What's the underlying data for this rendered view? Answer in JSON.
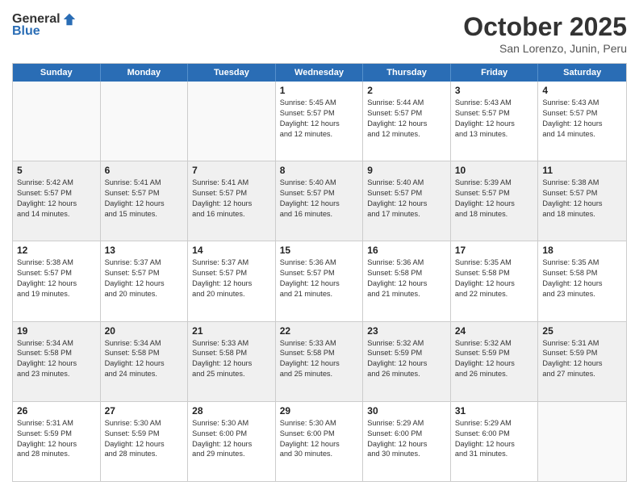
{
  "logo": {
    "general": "General",
    "blue": "Blue"
  },
  "title": "October 2025",
  "location": "San Lorenzo, Junin, Peru",
  "day_headers": [
    "Sunday",
    "Monday",
    "Tuesday",
    "Wednesday",
    "Thursday",
    "Friday",
    "Saturday"
  ],
  "weeks": [
    [
      {
        "day": "",
        "info": ""
      },
      {
        "day": "",
        "info": ""
      },
      {
        "day": "",
        "info": ""
      },
      {
        "day": "1",
        "info": "Sunrise: 5:45 AM\nSunset: 5:57 PM\nDaylight: 12 hours\nand 12 minutes."
      },
      {
        "day": "2",
        "info": "Sunrise: 5:44 AM\nSunset: 5:57 PM\nDaylight: 12 hours\nand 12 minutes."
      },
      {
        "day": "3",
        "info": "Sunrise: 5:43 AM\nSunset: 5:57 PM\nDaylight: 12 hours\nand 13 minutes."
      },
      {
        "day": "4",
        "info": "Sunrise: 5:43 AM\nSunset: 5:57 PM\nDaylight: 12 hours\nand 14 minutes."
      }
    ],
    [
      {
        "day": "5",
        "info": "Sunrise: 5:42 AM\nSunset: 5:57 PM\nDaylight: 12 hours\nand 14 minutes."
      },
      {
        "day": "6",
        "info": "Sunrise: 5:41 AM\nSunset: 5:57 PM\nDaylight: 12 hours\nand 15 minutes."
      },
      {
        "day": "7",
        "info": "Sunrise: 5:41 AM\nSunset: 5:57 PM\nDaylight: 12 hours\nand 16 minutes."
      },
      {
        "day": "8",
        "info": "Sunrise: 5:40 AM\nSunset: 5:57 PM\nDaylight: 12 hours\nand 16 minutes."
      },
      {
        "day": "9",
        "info": "Sunrise: 5:40 AM\nSunset: 5:57 PM\nDaylight: 12 hours\nand 17 minutes."
      },
      {
        "day": "10",
        "info": "Sunrise: 5:39 AM\nSunset: 5:57 PM\nDaylight: 12 hours\nand 18 minutes."
      },
      {
        "day": "11",
        "info": "Sunrise: 5:38 AM\nSunset: 5:57 PM\nDaylight: 12 hours\nand 18 minutes."
      }
    ],
    [
      {
        "day": "12",
        "info": "Sunrise: 5:38 AM\nSunset: 5:57 PM\nDaylight: 12 hours\nand 19 minutes."
      },
      {
        "day": "13",
        "info": "Sunrise: 5:37 AM\nSunset: 5:57 PM\nDaylight: 12 hours\nand 20 minutes."
      },
      {
        "day": "14",
        "info": "Sunrise: 5:37 AM\nSunset: 5:57 PM\nDaylight: 12 hours\nand 20 minutes."
      },
      {
        "day": "15",
        "info": "Sunrise: 5:36 AM\nSunset: 5:57 PM\nDaylight: 12 hours\nand 21 minutes."
      },
      {
        "day": "16",
        "info": "Sunrise: 5:36 AM\nSunset: 5:58 PM\nDaylight: 12 hours\nand 21 minutes."
      },
      {
        "day": "17",
        "info": "Sunrise: 5:35 AM\nSunset: 5:58 PM\nDaylight: 12 hours\nand 22 minutes."
      },
      {
        "day": "18",
        "info": "Sunrise: 5:35 AM\nSunset: 5:58 PM\nDaylight: 12 hours\nand 23 minutes."
      }
    ],
    [
      {
        "day": "19",
        "info": "Sunrise: 5:34 AM\nSunset: 5:58 PM\nDaylight: 12 hours\nand 23 minutes."
      },
      {
        "day": "20",
        "info": "Sunrise: 5:34 AM\nSunset: 5:58 PM\nDaylight: 12 hours\nand 24 minutes."
      },
      {
        "day": "21",
        "info": "Sunrise: 5:33 AM\nSunset: 5:58 PM\nDaylight: 12 hours\nand 25 minutes."
      },
      {
        "day": "22",
        "info": "Sunrise: 5:33 AM\nSunset: 5:58 PM\nDaylight: 12 hours\nand 25 minutes."
      },
      {
        "day": "23",
        "info": "Sunrise: 5:32 AM\nSunset: 5:59 PM\nDaylight: 12 hours\nand 26 minutes."
      },
      {
        "day": "24",
        "info": "Sunrise: 5:32 AM\nSunset: 5:59 PM\nDaylight: 12 hours\nand 26 minutes."
      },
      {
        "day": "25",
        "info": "Sunrise: 5:31 AM\nSunset: 5:59 PM\nDaylight: 12 hours\nand 27 minutes."
      }
    ],
    [
      {
        "day": "26",
        "info": "Sunrise: 5:31 AM\nSunset: 5:59 PM\nDaylight: 12 hours\nand 28 minutes."
      },
      {
        "day": "27",
        "info": "Sunrise: 5:30 AM\nSunset: 5:59 PM\nDaylight: 12 hours\nand 28 minutes."
      },
      {
        "day": "28",
        "info": "Sunrise: 5:30 AM\nSunset: 6:00 PM\nDaylight: 12 hours\nand 29 minutes."
      },
      {
        "day": "29",
        "info": "Sunrise: 5:30 AM\nSunset: 6:00 PM\nDaylight: 12 hours\nand 30 minutes."
      },
      {
        "day": "30",
        "info": "Sunrise: 5:29 AM\nSunset: 6:00 PM\nDaylight: 12 hours\nand 30 minutes."
      },
      {
        "day": "31",
        "info": "Sunrise: 5:29 AM\nSunset: 6:00 PM\nDaylight: 12 hours\nand 31 minutes."
      },
      {
        "day": "",
        "info": ""
      }
    ]
  ]
}
